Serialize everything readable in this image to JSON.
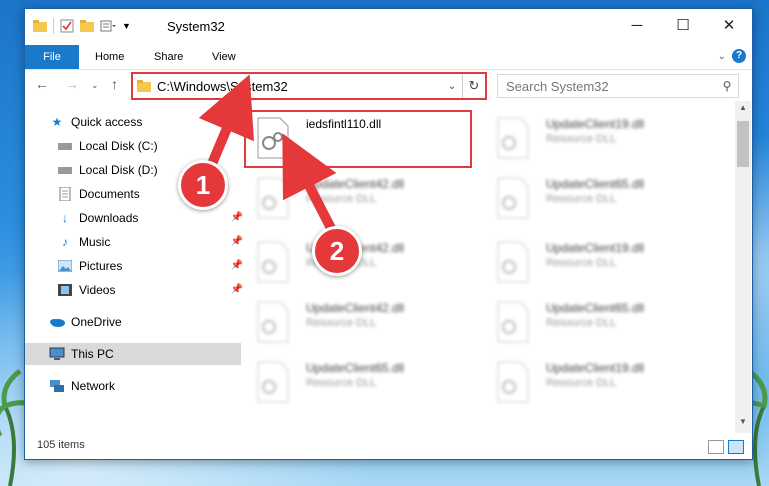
{
  "window": {
    "title": "System32"
  },
  "ribbon": {
    "tabs": [
      "File",
      "Home",
      "Share",
      "View"
    ]
  },
  "address": {
    "path": "C:\\Windows\\System32"
  },
  "search": {
    "placeholder": "Search System32"
  },
  "nav": {
    "items": [
      {
        "label": "Quick access",
        "icon": "star-icon"
      },
      {
        "label": "Local Disk (C:)",
        "icon": "drive-icon"
      },
      {
        "label": "Local Disk (D:)",
        "icon": "drive-icon"
      },
      {
        "label": "Documents",
        "icon": "documents-icon"
      },
      {
        "label": "Downloads",
        "icon": "download-icon"
      },
      {
        "label": "Music",
        "icon": "music-icon"
      },
      {
        "label": "Pictures",
        "icon": "pictures-icon"
      },
      {
        "label": "Videos",
        "icon": "videos-icon"
      },
      {
        "label": "OneDrive",
        "icon": "cloud-icon"
      },
      {
        "label": "This PC",
        "icon": "pc-icon"
      },
      {
        "label": "Network",
        "icon": "network-icon"
      }
    ]
  },
  "files": [
    {
      "name": "iedsfintl110.dll",
      "desc": ""
    },
    {
      "name": "UpdateClient19.dll",
      "desc": "Resource DLL"
    },
    {
      "name": "UpdateClient42.dll",
      "desc": "Resource DLL"
    },
    {
      "name": "UpdateClient65.dll",
      "desc": "Resource DLL"
    },
    {
      "name": "UpdateClient42.dll",
      "desc": "Resource DLL"
    },
    {
      "name": "UpdateClient19.dll",
      "desc": "Resource DLL"
    },
    {
      "name": "UpdateClient42.dll",
      "desc": "Resource DLL"
    },
    {
      "name": "UpdateClient65.dll",
      "desc": "Resource DLL"
    },
    {
      "name": "UpdateClient65.dll",
      "desc": "Resource DLL"
    },
    {
      "name": "UpdateClient19.dll",
      "desc": "Resource DLL"
    }
  ],
  "status": {
    "count": "105 items"
  },
  "annotations": {
    "step1": "1",
    "step2": "2",
    "color": "#e5383b"
  }
}
